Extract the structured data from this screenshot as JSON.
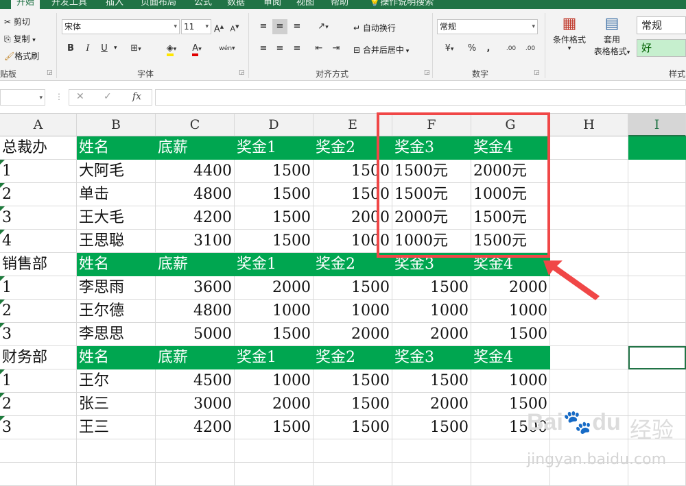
{
  "ribbon_tabs": [
    "开始",
    "开发工具",
    "插入",
    "页面布局",
    "公式",
    "数据",
    "审阅",
    "视图",
    "帮助",
    "操作说明搜索"
  ],
  "clipboard": {
    "cut": "剪切",
    "copy": "复制",
    "format_painter": "格式刷",
    "group_label": "贴板"
  },
  "font": {
    "name": "宋体",
    "size": "11",
    "bold": "B",
    "italic": "I",
    "underline": "U",
    "group_label": "字体",
    "grow": "A",
    "shrink": "A",
    "font_color": "A",
    "phonetic": "wén"
  },
  "alignment": {
    "wrap_text": "自动换行",
    "merge_center": "合并后居中",
    "group_label": "对齐方式"
  },
  "number": {
    "format": "常规",
    "percent": "%",
    "comma": ",",
    "inc_decimal": ".00",
    "dec_decimal": ".00",
    "group_label": "数字"
  },
  "styles": {
    "conditional_format": "条件格式",
    "table_format_line1": "套用",
    "table_format_line2": "表格格式",
    "style_normal": "常规",
    "style_good": "好",
    "group_label": "样式"
  },
  "formula_bar": {
    "name_box": "",
    "fx": "fx",
    "formula": ""
  },
  "columns": [
    "A",
    "B",
    "C",
    "D",
    "E",
    "F",
    "G",
    "H",
    "I"
  ],
  "selected_column": "I",
  "rows": [
    {
      "type": "header",
      "cells": [
        "总裁办",
        "姓名",
        "底薪",
        "奖金1",
        "奖金2",
        "奖金3",
        "奖金4"
      ]
    },
    {
      "type": "data",
      "cells": [
        "1",
        "大阿毛",
        "4400",
        "1500",
        "1500",
        "1500元",
        "2000元"
      ]
    },
    {
      "type": "data",
      "cells": [
        "2",
        "单击",
        "4800",
        "1500",
        "1500",
        "1500元",
        "1000元"
      ]
    },
    {
      "type": "data",
      "cells": [
        "3",
        "王大毛",
        "4200",
        "1500",
        "2000",
        "2000元",
        "1500元"
      ]
    },
    {
      "type": "data",
      "cells": [
        "4",
        "王思聪",
        "3100",
        "1500",
        "1000",
        "1000元",
        "1500元"
      ]
    },
    {
      "type": "header",
      "cells": [
        "销售部",
        "姓名",
        "底薪",
        "奖金1",
        "奖金2",
        "奖金3",
        "奖金4"
      ]
    },
    {
      "type": "data",
      "cells": [
        "1",
        "李思雨",
        "3600",
        "2000",
        "1500",
        "1500",
        "2000"
      ]
    },
    {
      "type": "data",
      "cells": [
        "2",
        "王尔德",
        "4800",
        "1000",
        "1000",
        "1000",
        "1000"
      ]
    },
    {
      "type": "data",
      "cells": [
        "3",
        "李思思",
        "5000",
        "1500",
        "2000",
        "2000",
        "1500"
      ]
    },
    {
      "type": "header",
      "cells": [
        "财务部",
        "姓名",
        "底薪",
        "奖金1",
        "奖金2",
        "奖金3",
        "奖金4"
      ]
    },
    {
      "type": "data",
      "cells": [
        "1",
        "王尔",
        "4500",
        "1000",
        "1500",
        "1500",
        "1000"
      ]
    },
    {
      "type": "data",
      "cells": [
        "2",
        "张三",
        "3000",
        "2000",
        "1500",
        "2000",
        "1500"
      ]
    },
    {
      "type": "data",
      "cells": [
        "3",
        "王三",
        "4200",
        "1500",
        "1500",
        "1500",
        "1500"
      ]
    },
    {
      "type": "empty",
      "cells": []
    },
    {
      "type": "empty",
      "cells": []
    }
  ],
  "watermark": {
    "brand": "Bai",
    "brand2": "du",
    "jingyan": "经验",
    "url": "jingyan.baidu.com"
  },
  "colors": {
    "accent": "#217346",
    "header_green": "#00a650",
    "highlight_red": "#f04747"
  }
}
